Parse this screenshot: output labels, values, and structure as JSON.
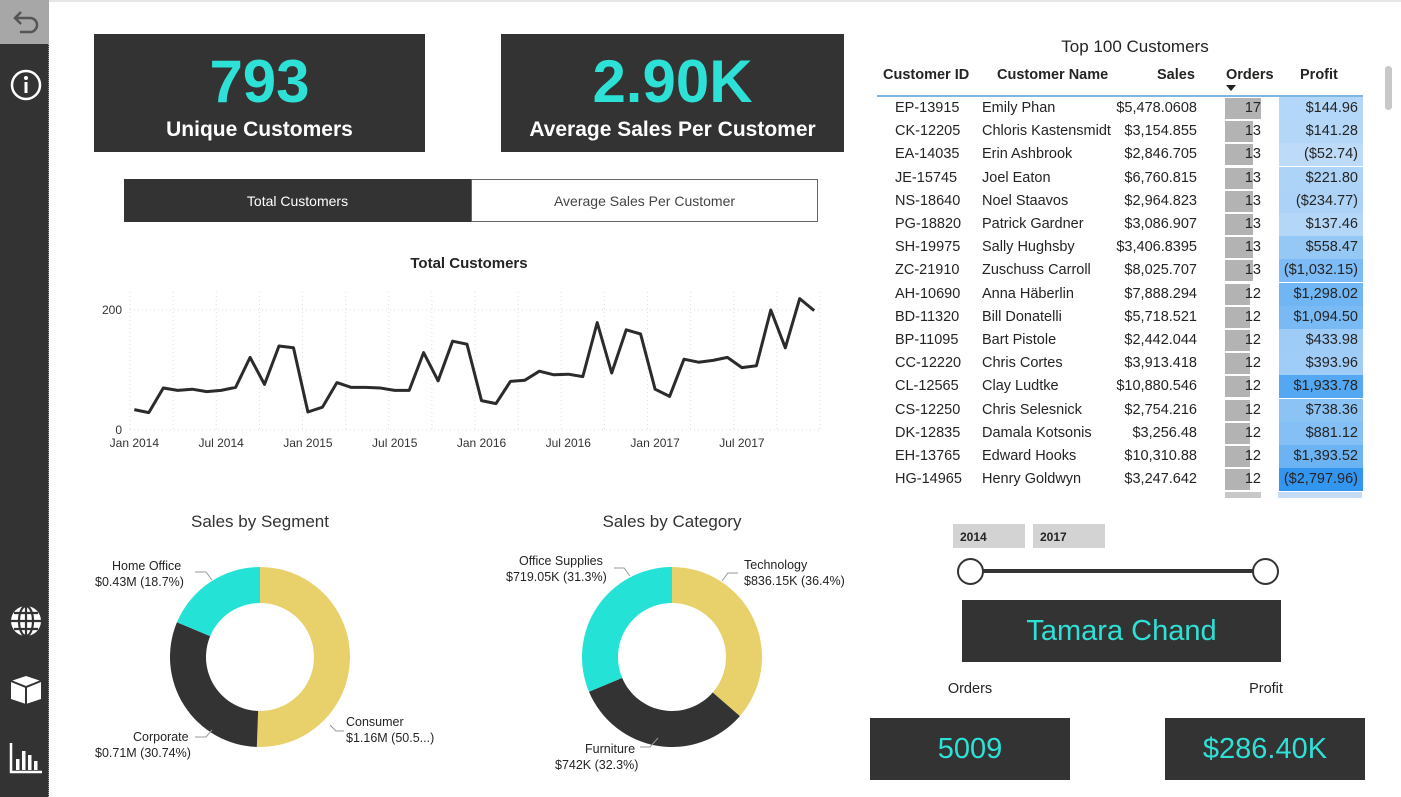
{
  "rail": {
    "icons": [
      "undo-arrow-icon",
      "info-icon",
      "globe-icon",
      "box-icon",
      "bar-chart-icon"
    ]
  },
  "kpis": {
    "customers_value": "793",
    "customers_label": "Unique Customers",
    "avg_value": "2.90K",
    "avg_label": "Average Sales Per Customer"
  },
  "toggle": {
    "active": "Total Customers",
    "inactive": "Average Sales Per Customer"
  },
  "line_chart": {
    "title": "Total Customers",
    "chart_data": {
      "type": "line",
      "ylim": [
        0,
        230
      ],
      "yticks": [
        "0",
        "200"
      ],
      "xticks": [
        "Jan 2014",
        "Jul 2014",
        "Jan 2015",
        "Jul 2015",
        "Jan 2016",
        "Jul 2016",
        "Jan 2017",
        "Jul 2017"
      ],
      "values": [
        34,
        29,
        70,
        66,
        68,
        64,
        66,
        71,
        121,
        76,
        140,
        137,
        30,
        38,
        79,
        71,
        71,
        70,
        66,
        66,
        129,
        82,
        148,
        143,
        49,
        44,
        81,
        83,
        98,
        92,
        93,
        89,
        179,
        95,
        167,
        160,
        68,
        56,
        118,
        113,
        116,
        121,
        104,
        107,
        200,
        137,
        219,
        199
      ]
    }
  },
  "segment": {
    "title": "Sales by Segment",
    "chart_data": {
      "type": "pie",
      "categories": [
        "Consumer",
        "Corporate",
        "Home Office"
      ],
      "values": [
        50.56,
        30.74,
        18.7
      ],
      "colors": [
        "#e8d06a",
        "#333333",
        "#24e2d5"
      ]
    },
    "labels": {
      "home_office_1": "Home Office",
      "home_office_2": "$0.43M (18.7%)",
      "corporate_1": "Corporate",
      "corporate_2": "$0.71M (30.74%)",
      "consumer_1": "Consumer",
      "consumer_2": "$1.16M (50.5...)"
    }
  },
  "category": {
    "title": "Sales by Category",
    "chart_data": {
      "type": "pie",
      "categories": [
        "Technology",
        "Furniture",
        "Office Supplies"
      ],
      "values": [
        36.4,
        32.3,
        31.3
      ],
      "colors": [
        "#e8d06a",
        "#333333",
        "#24e2d5"
      ]
    },
    "labels": {
      "office_1": "Office Supplies",
      "office_2": "$719.05K (31.3%)",
      "tech_1": "Technology",
      "tech_2": "$836.15K (36.4%)",
      "furn_1": "Furniture",
      "furn_2": "$742K (32.3%)"
    }
  },
  "table": {
    "title": "Top 100 Customers",
    "headers": [
      "Customer ID",
      "Customer Name",
      "Sales",
      "Orders",
      "Profit"
    ],
    "rows": [
      {
        "id": "EP-13915",
        "name": "Emily Phan",
        "sales": "$5,478.0608",
        "orders": "17",
        "profit": "$144.96",
        "pv": 144.96
      },
      {
        "id": "CK-12205",
        "name": "Chloris Kastensmidt",
        "sales": "$3,154.855",
        "orders": "13",
        "profit": "$141.28",
        "pv": 141.28
      },
      {
        "id": "EA-14035",
        "name": "Erin Ashbrook",
        "sales": "$2,846.705",
        "orders": "13",
        "profit": "($52.74)",
        "pv": -52.74
      },
      {
        "id": "JE-15745",
        "name": "Joel Eaton",
        "sales": "$6,760.815",
        "orders": "13",
        "profit": "$221.80",
        "pv": 221.8
      },
      {
        "id": "NS-18640",
        "name": "Noel Staavos",
        "sales": "$2,964.823",
        "orders": "13",
        "profit": "($234.77)",
        "pv": -234.77
      },
      {
        "id": "PG-18820",
        "name": "Patrick Gardner",
        "sales": "$3,086.907",
        "orders": "13",
        "profit": "$137.46",
        "pv": 137.46
      },
      {
        "id": "SH-19975",
        "name": "Sally Hughsby",
        "sales": "$3,406.8395",
        "orders": "13",
        "profit": "$558.47",
        "pv": 558.47
      },
      {
        "id": "ZC-21910",
        "name": "Zuschuss Carroll",
        "sales": "$8,025.707",
        "orders": "13",
        "profit": "($1,032.15)",
        "pv": -1032.15
      },
      {
        "id": "AH-10690",
        "name": "Anna Häberlin",
        "sales": "$7,888.294",
        "orders": "12",
        "profit": "$1,298.02",
        "pv": 1298.02
      },
      {
        "id": "BD-11320",
        "name": "Bill Donatelli",
        "sales": "$5,718.521",
        "orders": "12",
        "profit": "$1,094.50",
        "pv": 1094.5
      },
      {
        "id": "BP-11095",
        "name": "Bart Pistole",
        "sales": "$2,442.044",
        "orders": "12",
        "profit": "$433.98",
        "pv": 433.98
      },
      {
        "id": "CC-12220",
        "name": "Chris Cortes",
        "sales": "$3,913.418",
        "orders": "12",
        "profit": "$393.96",
        "pv": 393.96
      },
      {
        "id": "CL-12565",
        "name": "Clay Ludtke",
        "sales": "$10,880.546",
        "orders": "12",
        "profit": "$1,933.78",
        "pv": 1933.78
      },
      {
        "id": "CS-12250",
        "name": "Chris Selesnick",
        "sales": "$2,754.216",
        "orders": "12",
        "profit": "$738.36",
        "pv": 738.36
      },
      {
        "id": "DK-12835",
        "name": "Damala Kotsonis",
        "sales": "$3,256.48",
        "orders": "12",
        "profit": "$881.12",
        "pv": 881.12
      },
      {
        "id": "EH-13765",
        "name": "Edward Hooks",
        "sales": "$10,310.88",
        "orders": "12",
        "profit": "$1,393.52",
        "pv": 1393.52
      },
      {
        "id": "HG-14965",
        "name": "Henry Goldwyn",
        "sales": "$3,247.642",
        "orders": "12",
        "profit": "($2,797.96)",
        "pv": -2797.96
      }
    ]
  },
  "slicer": {
    "start": "2014",
    "end": "2017"
  },
  "selected_customer": "Tamara Chand",
  "orders_label": "Orders",
  "profit_label": "Profit",
  "orders_value": "5009",
  "profit_value": "$286.40K"
}
